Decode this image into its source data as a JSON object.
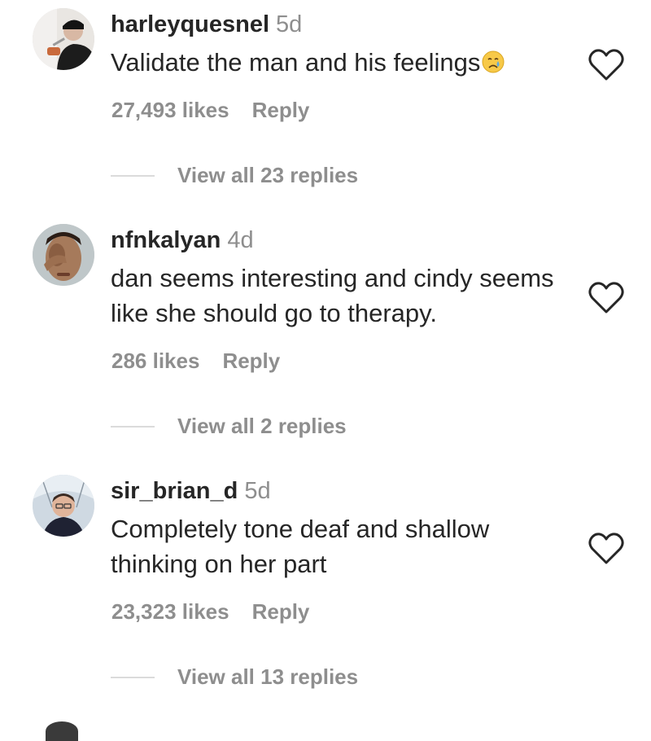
{
  "comments": [
    {
      "username": "harleyquesnel",
      "time": "5d",
      "text": "Validate the man and his feelings",
      "emoji": "crying-face-emoji",
      "likes": "27,493 likes",
      "reply": "Reply",
      "view_replies": "View all 23 replies"
    },
    {
      "username": "nfnkalyan",
      "time": "4d",
      "text": "dan seems interesting and cindy seems like she should go to therapy.",
      "likes": "286 likes",
      "reply": "Reply",
      "view_replies": "View all 2 replies"
    },
    {
      "username": "sir_brian_d",
      "time": "5d",
      "text": "Completely tone deaf and shallow thinking on her part",
      "likes": "23,323 likes",
      "reply": "Reply",
      "view_replies": "View all 13 replies"
    }
  ],
  "icons": {
    "like": "heart-outline-icon"
  },
  "colors": {
    "primary_text": "#262626",
    "secondary_text": "#8e8e8e",
    "divider": "#dbdbdb"
  }
}
